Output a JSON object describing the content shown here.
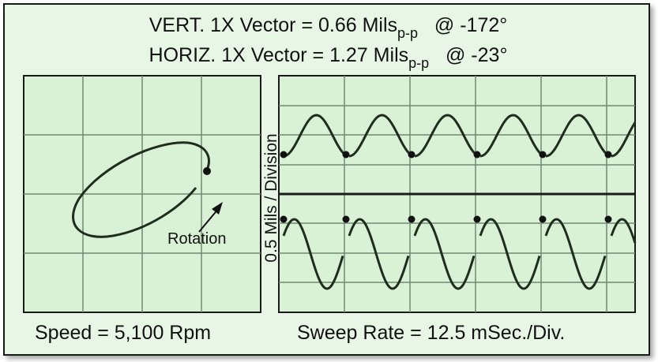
{
  "header": {
    "vert": {
      "prefix": "VERT. 1X Vector = 0.66 Mils",
      "sub": "p-p",
      "suffix": "@ -172°"
    },
    "horiz": {
      "prefix": "HORIZ. 1X Vector = 1.27 Mils",
      "sub": "p-p",
      "suffix": "@ -23°"
    }
  },
  "orbit": {
    "rotation_label": "Rotation"
  },
  "timebase": {
    "y_axis_label": "0.5 Mils / Division"
  },
  "footer": {
    "speed": "Speed = 5,100 Rpm",
    "sweep": "Sweep Rate = 12.5 mSec./Div."
  },
  "colors": {
    "screen": "#d9f2d6",
    "grid": "#6f8a72",
    "trace": "#1f2d1f",
    "border": "#1a1a1a"
  }
}
